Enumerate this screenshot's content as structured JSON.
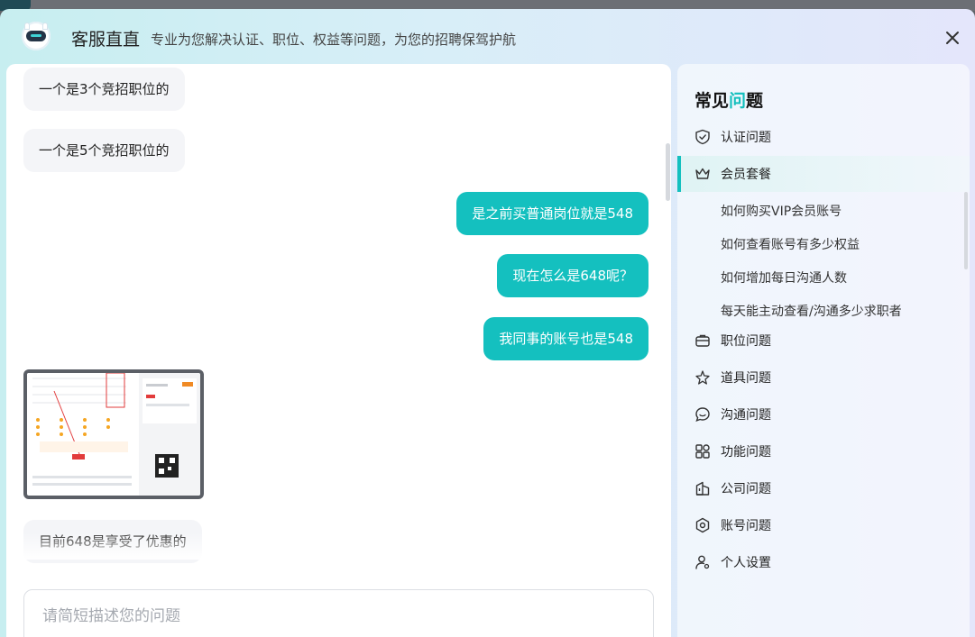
{
  "header": {
    "title": "客服直直",
    "subtitle": "专业为您解决认证、职位、权益等问题，为您的招聘保驾护航"
  },
  "chat": {
    "messages": [
      {
        "side": "in",
        "text": "一个是3个竞招职位的"
      },
      {
        "side": "in",
        "text": "一个是5个竞招职位的"
      },
      {
        "side": "out",
        "text": "是之前买普通岗位就是548"
      },
      {
        "side": "out",
        "text": "现在怎么是648呢？"
      },
      {
        "side": "out",
        "text": "我同事的账号也是548"
      },
      {
        "side": "in",
        "type": "image"
      },
      {
        "side": "in",
        "text": "目前648是享受了优惠的"
      }
    ],
    "input_placeholder": "请简短描述您的问题"
  },
  "faq": {
    "title_main": "常见",
    "title_accent": "问",
    "title_end": "题",
    "categories": [
      {
        "label": "认证问题",
        "icon": "shield-check-icon"
      },
      {
        "label": "会员套餐",
        "icon": "crown-icon",
        "active": true,
        "sub_items": [
          "如何购买VIP会员账号",
          "如何查看账号有多少权益",
          "如何增加每日沟通人数",
          "每天能主动查看/沟通多少求职者"
        ]
      },
      {
        "label": "职位问题",
        "icon": "briefcase-icon"
      },
      {
        "label": "道具问题",
        "icon": "sparkle-star-icon"
      },
      {
        "label": "沟通问题",
        "icon": "chat-bubble-icon"
      },
      {
        "label": "功能问题",
        "icon": "grid-icon"
      },
      {
        "label": "公司问题",
        "icon": "building-icon"
      },
      {
        "label": "账号问题",
        "icon": "hexagon-gear-icon"
      },
      {
        "label": "个人设置",
        "icon": "user-settings-icon"
      }
    ]
  },
  "colors": {
    "accent": "#14c0bf",
    "incoming_bubble": "#f4f5f8"
  }
}
